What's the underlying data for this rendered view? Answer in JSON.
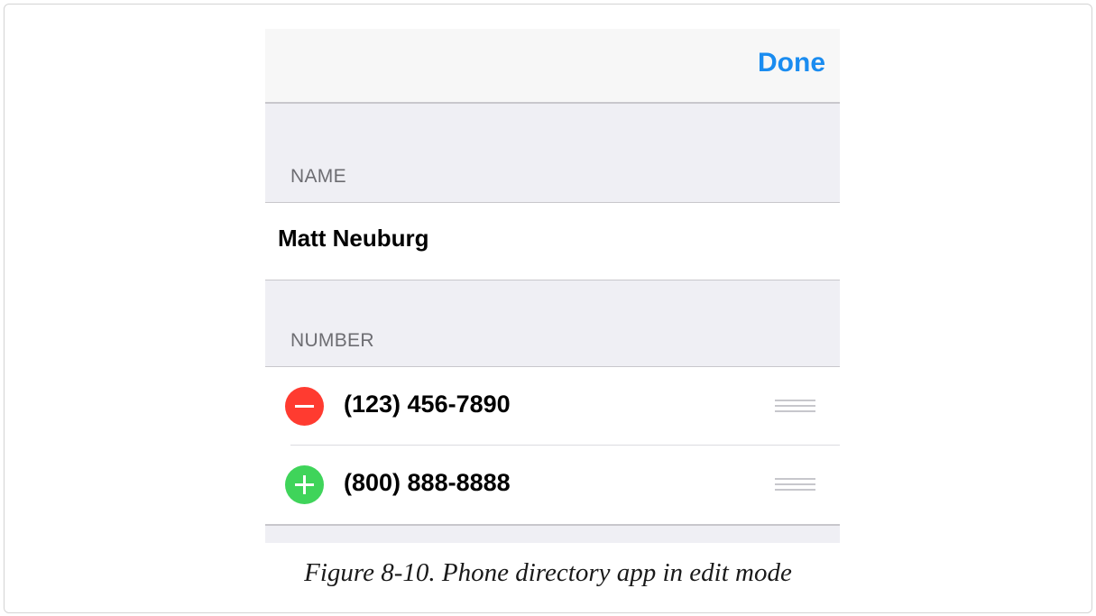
{
  "navbar": {
    "done_label": "Done"
  },
  "sections": {
    "name_header": "NAME",
    "number_header": "NUMBER"
  },
  "contact": {
    "name": "Matt Neuburg"
  },
  "numbers": [
    {
      "value": "(123) 456-7890",
      "control": "remove-circle-icon"
    },
    {
      "value": "(800) 888-8888",
      "control": "add-circle-icon"
    }
  ],
  "caption": "Figure 8-10. Phone directory app in edit mode",
  "colors": {
    "accent": "#1a8cf0",
    "delete": "#ff3b30",
    "insert": "#3fd45a",
    "grouped_background": "#efeff4"
  }
}
